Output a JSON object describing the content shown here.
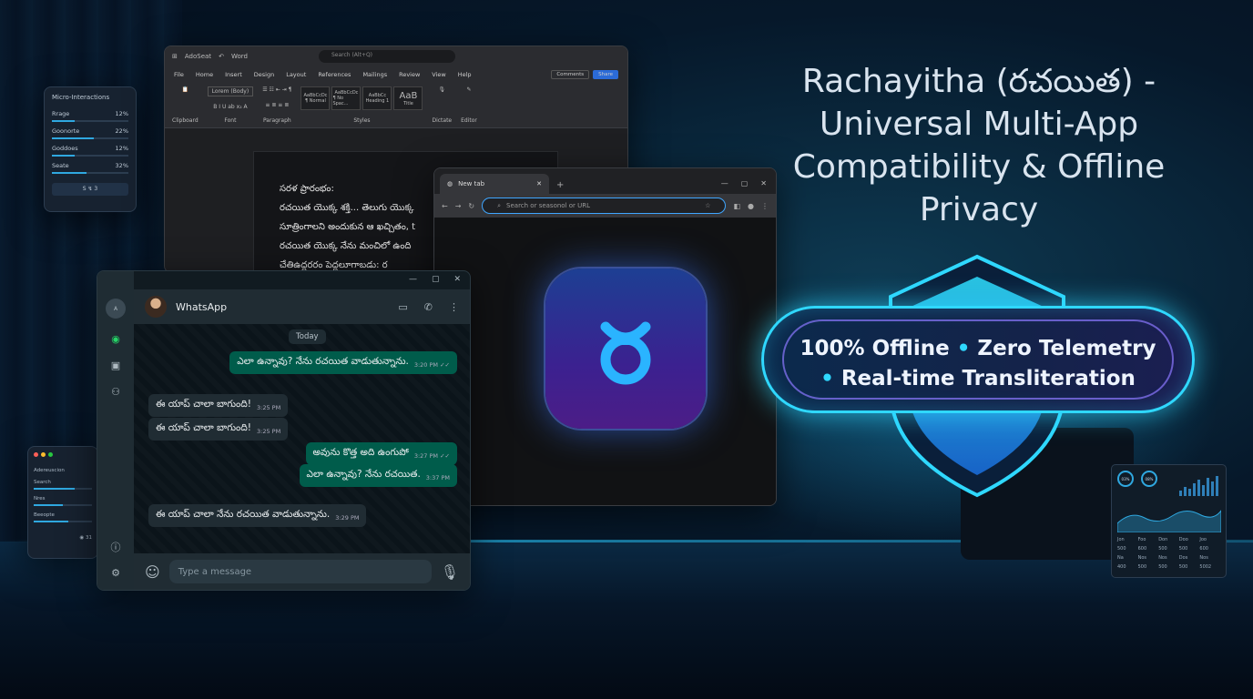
{
  "headline": {
    "line1": "Rachayitha (రచయిత) -",
    "line2": "Universal Multi-App",
    "line3": "Compatibility & Offline",
    "line4": "Privacy"
  },
  "badge": {
    "part1": "100% Offline",
    "part2": "Zero Telemetry",
    "part3": "Real-time Transliteration",
    "accent": "#2fd8ff"
  },
  "word": {
    "app_name": "AdoSeat",
    "doc_name": "Word",
    "search_placeholder": "Search (Alt+Q)",
    "menu": [
      "File",
      "Home",
      "Insert",
      "Design",
      "Layout",
      "References",
      "Mailings",
      "Review",
      "View",
      "Help"
    ],
    "comments": "Comments",
    "share": "Share",
    "font_name": "Lorem (Body)",
    "groups": [
      "Clipboard",
      "Font",
      "Paragraph",
      "Styles",
      "Dictate",
      "Editor"
    ],
    "styles": [
      {
        "sample": "AaBbCcDc",
        "name": "¶ Normal"
      },
      {
        "sample": "AaBbCcDc",
        "name": "¶ No Spac..."
      },
      {
        "sample": "AaBbCc",
        "name": "Heading 1"
      },
      {
        "sample": "AaB",
        "name": "Title"
      }
    ],
    "doc_lines": [
      "సరళ ప్రారంభం:",
      "రచయిత యొక్క శక్తి... తెలుగు యొక్క",
      "సూత్రింగాలని అందుకున ఆ ఖచ్చితం, t",
      "రచయిత యొక్క నేను మంచిలో ఉంది",
      "చేతిఉద్దరరం పెద్దలూగాబడు: ర"
    ]
  },
  "micro": {
    "title": "Micro-Interactions",
    "rows": [
      {
        "label": "Rrage",
        "value": "12%",
        "fill": 0.3
      },
      {
        "label": "Goonorte",
        "value": "22%",
        "fill": 0.55
      },
      {
        "label": "Goddoes",
        "value": "12%",
        "fill": 0.3
      },
      {
        "label": "Seate",
        "value": "32%",
        "fill": 0.45
      }
    ],
    "footer": "S ↯ 3"
  },
  "smallpanel": {
    "title": "Adereuscion",
    "items": [
      {
        "label": "Search",
        "fill": 0.7
      },
      {
        "label": "Nres",
        "fill": 0.5
      },
      {
        "label": "Beeopte",
        "fill": 0.6
      }
    ],
    "footer": "◉ 31"
  },
  "browser": {
    "tab_title": "New tab",
    "address_placeholder": "Search or seasonol or URL",
    "icon_glyph": "ర",
    "icon_colors": [
      "#1d3f93",
      "#4c1d87"
    ]
  },
  "whatsapp": {
    "title": "WhatsApp",
    "date_chip": "Today",
    "input_placeholder": "Type a message",
    "messages": [
      {
        "text": "ఎలా ఉన్నావు? నేను రచయిత వాడుతున్నాను.",
        "time": "3:20 PM ✓✓",
        "dir": "out"
      },
      {
        "text": "ఈ యాప్ చాలా బాగుంది!",
        "time": "3:25 PM",
        "dir": "in"
      },
      {
        "text": "ఈ యాప్ చాలా బాగుంది!",
        "time": "3:25 PM",
        "dir": "in"
      },
      {
        "text": "అవును కొత్త అది ఉంగుపో",
        "time": "3:27 PM ✓✓",
        "dir": "out"
      },
      {
        "text": "ఎలా ఉన్నావు? నేను రచయిత.",
        "time": "3:37 PM",
        "dir": "out"
      },
      {
        "text": "ఈ యాప్ చాలా నేను రచయిత వాడుతున్నాను.",
        "time": "3:29 PM",
        "dir": "in"
      }
    ],
    "accent": "#25d366"
  },
  "dashboard": {
    "rings": [
      "03%",
      "08%"
    ],
    "grid": [
      "Jon",
      "Foo",
      "Don",
      "Doo",
      "Joo",
      "500",
      "600",
      "500",
      "500",
      "600",
      "Na",
      "Nos",
      "Nos",
      "Dos",
      "Nos",
      "400",
      "500",
      "500",
      "500",
      "5002"
    ]
  }
}
